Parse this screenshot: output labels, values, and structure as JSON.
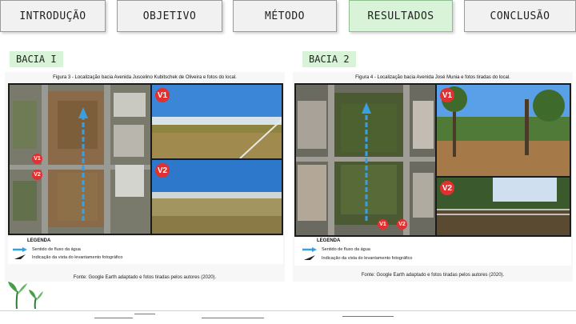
{
  "nav": {
    "tabs": [
      {
        "label": "INTRODUÇÃO"
      },
      {
        "label": "OBJETIVO"
      },
      {
        "label": "MÉTODO"
      },
      {
        "label": "RESULTADOS"
      },
      {
        "label": "CONCLUSÃO"
      }
    ],
    "active_tab": "RESULTADOS"
  },
  "basins": [
    {
      "heading": "BACIA I",
      "figure_caption": "Figura 3 - Localização bacia Avenida Juscelino Kubitschek de Oliveira e fotos do local.",
      "photo_labels": [
        "V1",
        "V2"
      ],
      "map_labels": [
        "V1",
        "V2"
      ],
      "legend_title": "LEGENDA",
      "legend_items": [
        "Sentido de fluxo da água",
        "Indicação da vista do levantamento fotográfico"
      ],
      "source": "Fonte: Google Earth adaptado e fotos tiradas pelos autores (2020)."
    },
    {
      "heading": "BACIA 2",
      "figure_caption": "Figura 4 - Localização bacia Avenida José Munia e fotos tiradas do local.",
      "photo_labels": [
        "V1",
        "V2"
      ],
      "map_labels": [
        "V1",
        "V2"
      ],
      "legend_title": "LEGENDA",
      "legend_items": [
        "Sentido de fluxo da água",
        "Indicação da vista do levantamento fotográfico"
      ],
      "source": "Fonte: Google Earth adaptado e fotos tiradas pelos autores (2020)."
    }
  ],
  "colors": {
    "active_tab": "#d8f3d8",
    "flow_arrow": "#3a9fe0",
    "badge": "#e03030"
  },
  "icons": [
    "sprout-icon",
    "flow-arrow-icon",
    "view-direction-icon"
  ]
}
